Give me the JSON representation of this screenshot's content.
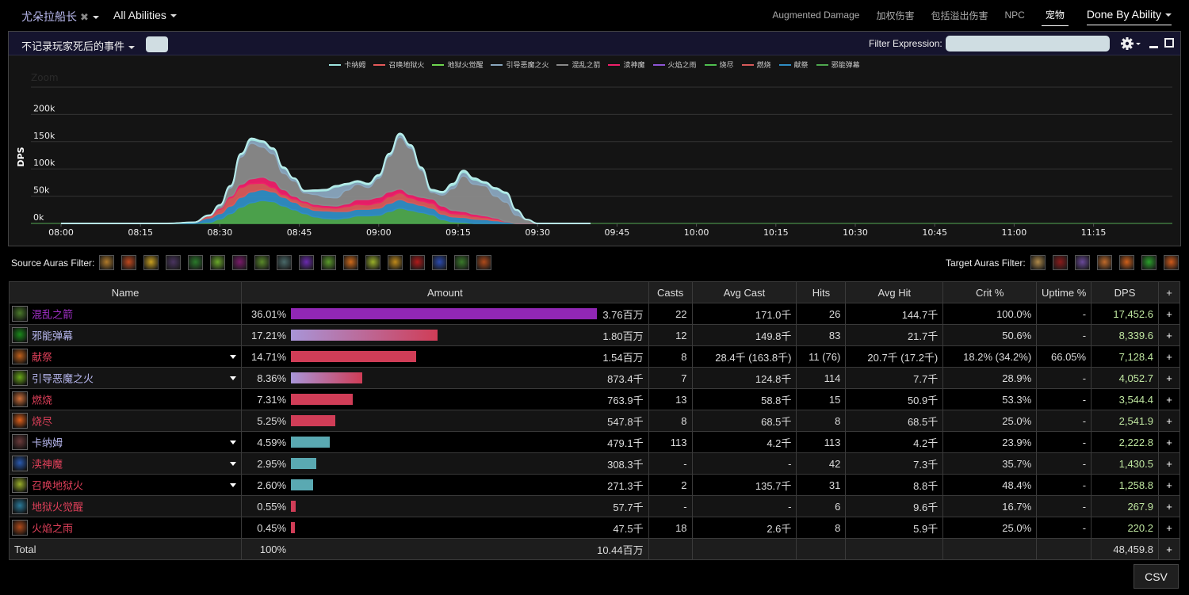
{
  "topbar": {
    "actor": "尤朵拉船长",
    "abilities": "All Abilities",
    "tabs": [
      "Augmented Damage",
      "加权伤害",
      "包括溢出伤害",
      "NPC",
      "宠物"
    ],
    "active_tab": "宠物",
    "view_mode": "Done By Ability"
  },
  "panel": {
    "death_filter": "不记录玩家死后的事件",
    "filter_label": "Filter Expression:",
    "filter_value": ""
  },
  "chart_data": {
    "type": "area",
    "stacked": true,
    "zoom_label": "Zoom",
    "ylabel": "DPS",
    "xlabel": "",
    "ylim": [
      0,
      250000
    ],
    "y_ticks": [
      "0k",
      "50k",
      "100k",
      "150k",
      "200k"
    ],
    "x_ticks": [
      "08:00",
      "08:15",
      "08:30",
      "08:45",
      "09:00",
      "09:15",
      "09:30",
      "09:45",
      "10:00",
      "10:15",
      "10:30",
      "10:45",
      "11:00",
      "11:15"
    ],
    "x_unit": "minutes since 08:00",
    "xlim": [
      -7,
      100
    ],
    "legend": "top-center",
    "grid": true,
    "x": [
      0,
      20,
      25,
      28,
      30,
      32,
      34,
      36,
      38,
      40,
      42,
      44,
      46,
      48,
      50,
      52,
      54,
      56,
      58,
      60,
      62,
      64,
      66,
      68,
      70,
      72,
      74,
      76,
      78,
      80,
      82,
      84,
      86,
      88,
      90,
      92,
      94,
      96,
      98,
      100
    ],
    "series": [
      {
        "name": "献祭",
        "color": "#4ea84e",
        "role": "base-green",
        "values": [
          0,
          0,
          0,
          200,
          800,
          1800,
          3000,
          3800,
          4200,
          4000,
          3200,
          2500,
          1800,
          1200,
          900,
          800,
          1000,
          1400,
          1400,
          1500,
          2200,
          2800,
          2400,
          2000,
          1600,
          700,
          300,
          200,
          0,
          0,
          0,
          0,
          0,
          0,
          0,
          0,
          0,
          0,
          0,
          0
        ]
      },
      {
        "name": "邪能弹幕",
        "color": "#2f8dc4",
        "values": [
          0,
          0,
          200,
          800,
          1000,
          1400,
          1800,
          2000,
          2000,
          1800,
          1600,
          1400,
          1200,
          1200,
          1400,
          1400,
          1200,
          1200,
          1200,
          1300,
          1500,
          1600,
          1400,
          1300,
          1200,
          1000,
          900,
          900,
          800,
          700,
          500,
          300,
          0,
          0,
          0,
          0,
          0,
          0,
          0,
          0
        ]
      },
      {
        "name": "燃烧",
        "color": "#d85a5a",
        "values": [
          0,
          0,
          0,
          400,
          800,
          1500,
          1800,
          1500,
          1200,
          800,
          500,
          600,
          800,
          700,
          600,
          600,
          900,
          900,
          800,
          1000,
          1200,
          1200,
          900,
          800,
          900,
          700,
          600,
          600,
          500,
          400,
          300,
          100,
          0,
          0,
          0,
          0,
          0,
          0,
          0,
          0
        ]
      },
      {
        "name": "渎神魔",
        "color": "#ef1f6a",
        "values": [
          0,
          0,
          0,
          0,
          200,
          300,
          600,
          900,
          1100,
          1200,
          900,
          500,
          300,
          400,
          400,
          400,
          500,
          900,
          1000,
          1000,
          900,
          700,
          600,
          700,
          800,
          800,
          600,
          500,
          400,
          300,
          200,
          0,
          0,
          0,
          0,
          0,
          0,
          0,
          0,
          0
        ]
      },
      {
        "name": "混乱之箭",
        "color": "#8a8a8a",
        "values": [
          0,
          0,
          0,
          0,
          300,
          1500,
          5000,
          6500,
          5500,
          5000,
          3000,
          2800,
          1500,
          1800,
          1500,
          1500,
          2500,
          2800,
          2200,
          3500,
          6500,
          9500,
          8500,
          5000,
          1200,
          2000,
          4000,
          6500,
          5500,
          5500,
          4000,
          3500,
          1500,
          700,
          0,
          0,
          0,
          0,
          0,
          0
        ]
      },
      {
        "name": "引导恶魔之火",
        "color": "#8aa7bf",
        "values": [
          0,
          0,
          0,
          0,
          200,
          300,
          400,
          600,
          900,
          800,
          900,
          400,
          300,
          600,
          1200,
          2000,
          1000,
          400,
          500,
          400,
          300,
          500,
          400,
          300,
          300,
          400,
          600,
          700,
          800,
          500,
          1300,
          1600,
          900,
          0,
          0,
          0,
          0,
          0,
          0,
          0
        ]
      },
      {
        "name": "卡纳姆",
        "color": "#9fe6e0",
        "values": [
          0,
          0,
          0,
          100,
          100,
          100,
          200,
          300,
          200,
          200,
          200,
          100,
          100,
          200,
          200,
          200,
          200,
          200,
          200,
          200,
          200,
          200,
          200,
          200,
          200,
          200,
          300,
          300,
          300,
          200,
          200,
          200,
          100,
          0,
          0,
          0,
          0,
          0,
          0,
          0
        ]
      },
      {
        "name": "召唤地狱火",
        "color": "#e65a5a",
        "values": []
      },
      {
        "name": "地狱火觉醒",
        "color": "#6ed64e",
        "values": []
      },
      {
        "name": "火焰之雨",
        "color": "#8e55d6",
        "values": []
      },
      {
        "name": "烧尽",
        "color": "#4fc04f",
        "values": []
      }
    ],
    "value_scale": 10,
    "legend_order": [
      "卡纳姆",
      "召唤地狱火",
      "地狱火觉醒",
      "引导恶魔之火",
      "混乱之箭",
      "渎神魔",
      "火焰之雨",
      "烧尽",
      "燃烧",
      "献祭",
      "邪能弹幕"
    ],
    "legend_colors": [
      "#9fe6e0",
      "#e65a5a",
      "#6ed64e",
      "#8aa7bf",
      "#8a8a8a",
      "#ef1f6a",
      "#8e55d6",
      "#4fc04f",
      "#d85a5a",
      "#2f8dc4",
      "#4ea84e"
    ]
  },
  "auras": {
    "source_label": "Source Auras Filter:",
    "source_icons": [
      {
        "name": "aura-gold-rune",
        "color": "#b07a2a"
      },
      {
        "name": "aura-fire-shard",
        "color": "#c0481c"
      },
      {
        "name": "aura-golden-sigil",
        "color": "#c9a020"
      },
      {
        "name": "aura-dark-strike",
        "color": "#4a3460"
      },
      {
        "name": "aura-green-rune",
        "color": "#2a7a2a"
      },
      {
        "name": "aura-green-flame",
        "color": "#6aa82a"
      },
      {
        "name": "aura-void-orb",
        "color": "#7a1a6a"
      },
      {
        "name": "aura-demon-face",
        "color": "#5a8a2a"
      },
      {
        "name": "aura-stone-golem",
        "color": "#4a6a6a"
      },
      {
        "name": "aura-purple-skull",
        "color": "#6a2ab0"
      },
      {
        "name": "aura-fel-swirl",
        "color": "#5a9a2a"
      },
      {
        "name": "aura-flame-burst",
        "color": "#d06a1a"
      },
      {
        "name": "aura-infernal",
        "color": "#9ab02a"
      },
      {
        "name": "aura-pyramid",
        "color": "#c08a1a"
      },
      {
        "name": "aura-red-demon",
        "color": "#b01a1a"
      },
      {
        "name": "aura-blue-slash",
        "color": "#2a4ab0"
      },
      {
        "name": "aura-green-warrior",
        "color": "#3a7a2a"
      },
      {
        "name": "aura-fire-rain",
        "color": "#b04a1a"
      }
    ],
    "target_label": "Target Auras Filter:",
    "target_icons": [
      {
        "name": "aura-golden-figure",
        "color": "#b08a4a"
      },
      {
        "name": "aura-red-beast",
        "color": "#8a1a1a"
      },
      {
        "name": "aura-purple-demon",
        "color": "#6a4a9a"
      },
      {
        "name": "aura-ember",
        "color": "#c06a2a"
      },
      {
        "name": "aura-immolate",
        "color": "#d0601a"
      },
      {
        "name": "aura-green-eye",
        "color": "#2aa02a"
      },
      {
        "name": "aura-fire-ring",
        "color": "#d05a1a"
      }
    ]
  },
  "table": {
    "columns": [
      "Name",
      "Amount",
      "Casts",
      "Avg Cast",
      "Hits",
      "Avg Hit",
      "Crit %",
      "Uptime %",
      "DPS",
      "+"
    ],
    "rows": [
      {
        "name": "混乱之箭",
        "name_color": "#a330c9",
        "icon_color": "#4a7a2a",
        "expandable": false,
        "pct": "36.01%",
        "fraction": 1.0,
        "bar": "solid-purple",
        "amount": "3.76百万",
        "casts": "22",
        "avg_cast": "171.0千",
        "hits": "26",
        "avg_hit": "144.7千",
        "crit": "100.0%",
        "uptime": "-",
        "dps": "17,452.6"
      },
      {
        "name": "邪能弹幕",
        "name_color": "#b8b8f0",
        "icon_color": "#1a8a1a",
        "expandable": false,
        "pct": "17.21%",
        "fraction": 0.478,
        "bar": "gradient",
        "amount": "1.80百万",
        "casts": "12",
        "avg_cast": "149.8千",
        "hits": "83",
        "avg_hit": "21.7千",
        "crit": "50.6%",
        "uptime": "-",
        "dps": "8,339.6"
      },
      {
        "name": "献祭",
        "name_color": "#e0405a",
        "icon_color": "#c0601a",
        "expandable": true,
        "pct": "14.71%",
        "fraction": 0.408,
        "bar": "solid-red",
        "amount": "1.54百万",
        "casts": "8",
        "avg_cast": "28.4千 (163.8千)",
        "hits": "11 (76)",
        "avg_hit": "20.7千 (17.2千)",
        "crit": "18.2% (34.2%)",
        "uptime": "66.05%",
        "dps": "7,128.4"
      },
      {
        "name": "引导恶魔之火",
        "name_color": "#b8b8f0",
        "icon_color": "#6aa81a",
        "expandable": true,
        "pct": "8.36%",
        "fraction": 0.232,
        "bar": "gradient",
        "amount": "873.4千",
        "casts": "7",
        "avg_cast": "124.8千",
        "hits": "114",
        "avg_hit": "7.7千",
        "crit": "28.9%",
        "uptime": "-",
        "dps": "4,052.7"
      },
      {
        "name": "燃烧",
        "name_color": "#e0405a",
        "icon_color": "#d0703a",
        "expandable": false,
        "pct": "7.31%",
        "fraction": 0.203,
        "bar": "solid-red",
        "amount": "763.9千",
        "casts": "13",
        "avg_cast": "58.8千",
        "hits": "15",
        "avg_hit": "50.9千",
        "crit": "53.3%",
        "uptime": "-",
        "dps": "3,544.4"
      },
      {
        "name": "烧尽",
        "name_color": "#e0405a",
        "icon_color": "#e0601a",
        "expandable": false,
        "pct": "5.25%",
        "fraction": 0.146,
        "bar": "solid-red",
        "amount": "547.8千",
        "casts": "8",
        "avg_cast": "68.5千",
        "hits": "8",
        "avg_hit": "68.5千",
        "crit": "25.0%",
        "uptime": "-",
        "dps": "2,541.9"
      },
      {
        "name": "卡纳姆",
        "name_color": "#b8b8f0",
        "icon_color": "#6a3a3a",
        "expandable": true,
        "pct": "4.59%",
        "fraction": 0.127,
        "bar": "solid-teal",
        "amount": "479.1千",
        "casts": "113",
        "avg_cast": "4.2千",
        "hits": "113",
        "avg_hit": "4.2千",
        "crit": "23.9%",
        "uptime": "-",
        "dps": "2,222.8"
      },
      {
        "name": "渎神魔",
        "name_color": "#e0405a",
        "icon_color": "#2a5ab0",
        "expandable": true,
        "pct": "2.95%",
        "fraction": 0.082,
        "bar": "solid-teal",
        "amount": "308.3千",
        "casts": "-",
        "avg_cast": "-",
        "hits": "42",
        "avg_hit": "7.3千",
        "crit": "35.7%",
        "uptime": "-",
        "dps": "1,430.5"
      },
      {
        "name": "召唤地狱火",
        "name_color": "#e0405a",
        "icon_color": "#9ab02a",
        "expandable": true,
        "pct": "2.60%",
        "fraction": 0.072,
        "bar": "solid-teal",
        "amount": "271.3千",
        "casts": "2",
        "avg_cast": "135.7千",
        "hits": "31",
        "avg_hit": "8.8千",
        "crit": "48.4%",
        "uptime": "-",
        "dps": "1,258.8"
      },
      {
        "name": "地狱火觉醒",
        "name_color": "#e0405a",
        "icon_color": "#2a7a9a",
        "expandable": false,
        "pct": "0.55%",
        "fraction": 0.015,
        "bar": "solid-red",
        "amount": "57.7千",
        "casts": "-",
        "avg_cast": "-",
        "hits": "6",
        "avg_hit": "9.6千",
        "crit": "16.7%",
        "uptime": "-",
        "dps": "267.9"
      },
      {
        "name": "火焰之雨",
        "name_color": "#e0405a",
        "icon_color": "#b04a1a",
        "expandable": false,
        "pct": "0.45%",
        "fraction": 0.0125,
        "bar": "solid-red",
        "amount": "47.5千",
        "casts": "18",
        "avg_cast": "2.6千",
        "hits": "8",
        "avg_hit": "5.9千",
        "crit": "25.0%",
        "uptime": "-",
        "dps": "220.2"
      }
    ],
    "total": {
      "label": "Total",
      "pct": "100%",
      "amount": "10.44百万",
      "dps": "48,459.8"
    }
  },
  "csv_label": "CSV",
  "colors": {
    "bar_purple": "#9127b5",
    "bar_red": "#d03d57",
    "bar_teal": "#5aa9b2",
    "bar_gradient_start": "#a895d8",
    "dps_text": "#bfe6a0",
    "panel_header": "#15142e"
  }
}
